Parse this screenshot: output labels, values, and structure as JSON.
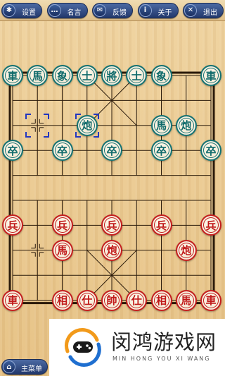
{
  "toolbar": {
    "settings": {
      "label": "设置",
      "icon": "gear-icon"
    },
    "quotes": {
      "label": "名言",
      "icon": "chat-icon"
    },
    "feedback": {
      "label": "反馈",
      "icon": "mail-icon"
    },
    "about": {
      "label": "关于",
      "icon": "info-icon"
    },
    "exit": {
      "label": "退出",
      "icon": "close-icon"
    }
  },
  "board": {
    "columns": 9,
    "rows": 10,
    "green_pieces": [
      {
        "char": "車",
        "col": 0,
        "row": 0
      },
      {
        "char": "馬",
        "col": 1,
        "row": 0
      },
      {
        "char": "象",
        "col": 2,
        "row": 0
      },
      {
        "char": "士",
        "col": 3,
        "row": 0
      },
      {
        "char": "將",
        "col": 4,
        "row": 0
      },
      {
        "char": "士",
        "col": 5,
        "row": 0
      },
      {
        "char": "象",
        "col": 6,
        "row": 0
      },
      {
        "char": "車",
        "col": 8,
        "row": 0
      },
      {
        "char": "炮",
        "col": 3,
        "row": 2
      },
      {
        "char": "馬",
        "col": 6,
        "row": 2
      },
      {
        "char": "炮",
        "col": 7,
        "row": 2
      },
      {
        "char": "卒",
        "col": 0,
        "row": 3
      },
      {
        "char": "卒",
        "col": 2,
        "row": 3
      },
      {
        "char": "卒",
        "col": 4,
        "row": 3
      },
      {
        "char": "卒",
        "col": 6,
        "row": 3
      },
      {
        "char": "卒",
        "col": 8,
        "row": 3
      }
    ],
    "red_pieces": [
      {
        "char": "兵",
        "col": 0,
        "row": 6
      },
      {
        "char": "兵",
        "col": 2,
        "row": 6
      },
      {
        "char": "兵",
        "col": 4,
        "row": 6
      },
      {
        "char": "兵",
        "col": 6,
        "row": 6
      },
      {
        "char": "兵",
        "col": 8,
        "row": 6
      },
      {
        "char": "馬",
        "col": 2,
        "row": 7
      },
      {
        "char": "炮",
        "col": 4,
        "row": 7
      },
      {
        "char": "炮",
        "col": 7,
        "row": 7
      },
      {
        "char": "車",
        "col": 0,
        "row": 9
      },
      {
        "char": "相",
        "col": 2,
        "row": 9
      },
      {
        "char": "仕",
        "col": 3,
        "row": 9
      },
      {
        "char": "帥",
        "col": 4,
        "row": 9
      },
      {
        "char": "仕",
        "col": 5,
        "row": 9
      },
      {
        "char": "相",
        "col": 6,
        "row": 9
      },
      {
        "char": "馬",
        "col": 7,
        "row": 9
      },
      {
        "char": "車",
        "col": 8,
        "row": 9
      }
    ],
    "last_move_from": {
      "col": 1,
      "row": 2
    },
    "last_move_to": {
      "col": 3,
      "row": 2
    },
    "colors": {
      "green": "#147272",
      "red": "#c41e1e",
      "selection": "#2236c0"
    }
  },
  "ad": {
    "title": "闵鸿游戏网",
    "subtitle": "MIN HONG YOU XI WANG"
  },
  "bottom": {
    "main_menu": {
      "label": "主菜单",
      "icon": "home-icon"
    }
  }
}
